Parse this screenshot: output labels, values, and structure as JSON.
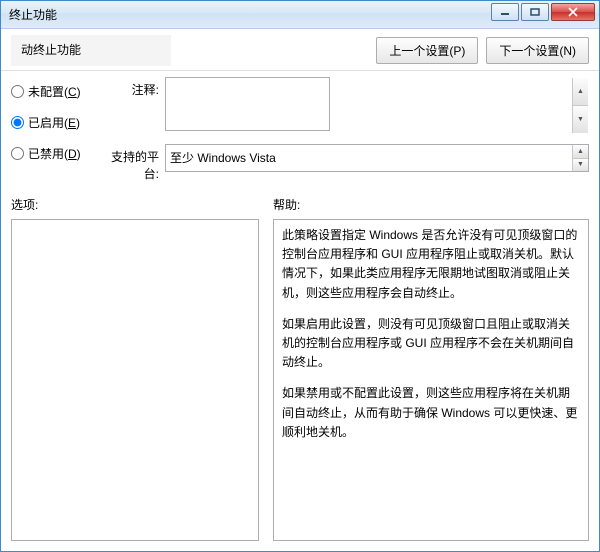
{
  "titlebar": {
    "title_suffix": "终止功能"
  },
  "header": {
    "heading_suffix": "动终止功能",
    "prev_btn": "上一个设置(P)",
    "next_btn": "下一个设置(N)"
  },
  "radios": {
    "not_configured": "未配置(C)",
    "enabled": "已启用(E)",
    "disabled": "已禁用(D)",
    "selected": "enabled"
  },
  "fields": {
    "comment_label": "注释:",
    "comment_value": "",
    "platform_label": "支持的平台:",
    "platform_value": "至少 Windows Vista"
  },
  "split": {
    "options_label": "选项:",
    "help_label": "帮助:"
  },
  "help": {
    "p1": "此策略设置指定 Windows 是否允许没有可见顶级窗口的控制台应用程序和 GUI 应用程序阻止或取消关机。默认情况下，如果此类应用程序无限期地试图取消或阻止关机，则这些应用程序会自动终止。",
    "p2": "如果启用此设置，则没有可见顶级窗口且阻止或取消关机的控制台应用程序或 GUI 应用程序不会在关机期间自动终止。",
    "p3": "如果禁用或不配置此设置，则这些应用程序将在关机期间自动终止，从而有助于确保 Windows 可以更快速、更顺利地关机。"
  },
  "window_controls": {
    "minimize": "minimize",
    "maximize": "maximize",
    "close": "close"
  }
}
